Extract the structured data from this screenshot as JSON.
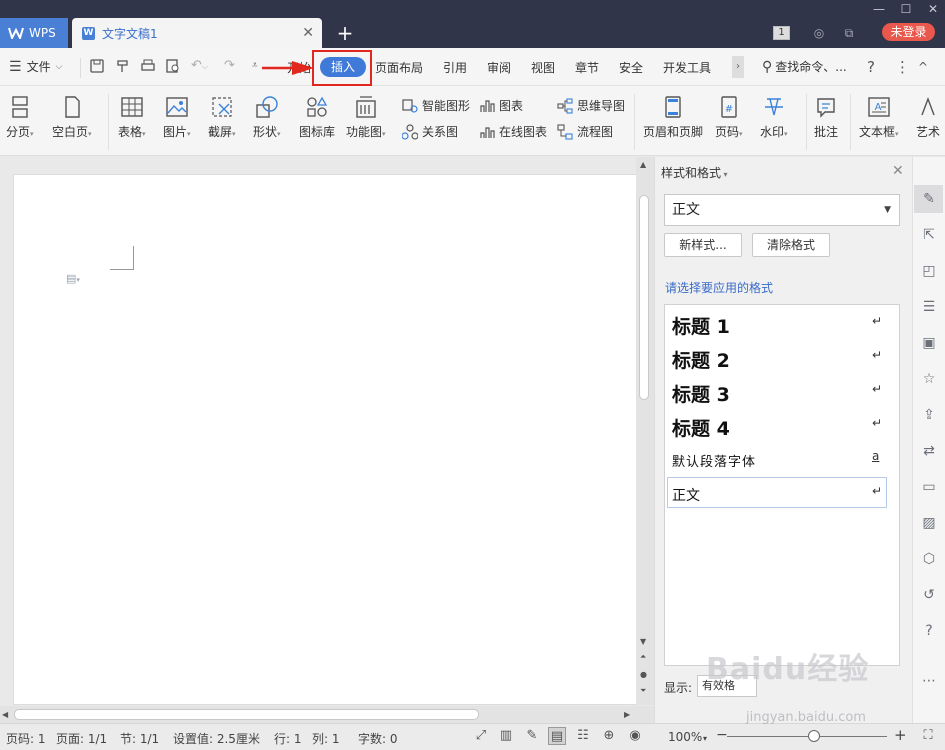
{
  "titlebar": {
    "app_tab": "WPS",
    "doc_tab": "文字文稿1",
    "doc_logo": "W",
    "window_count": "1",
    "login": "未登录",
    "colors": {
      "bg": "#30354a",
      "app_tab": "#4a7fd6",
      "login": "#e8584d"
    }
  },
  "menubar": {
    "file": "文件",
    "tabs": [
      "开始",
      "插入",
      "页面布局",
      "引用",
      "审阅",
      "视图",
      "章节",
      "安全",
      "开发工具"
    ],
    "active_tab": "插入",
    "search": "查找命令、...",
    "help": "?",
    "more": "⋮",
    "collapse": "^"
  },
  "ribbon": {
    "page_break": "分页",
    "blank_page": "空白页",
    "table": "表格",
    "picture": "图片",
    "screenshot": "截屏",
    "shapes": "形状",
    "icon_library": "图标库",
    "function_chart": "功能图",
    "smart_art": "智能图形",
    "chart": "图表",
    "relation_chart": "关系图",
    "online_chart": "在线图表",
    "mind_map": "思维导图",
    "flowchart": "流程图",
    "header_footer": "页眉和页脚",
    "page_number": "页码",
    "watermark": "水印",
    "comment": "批注",
    "text_box": "文本框",
    "art_text": "艺术"
  },
  "styles_pane": {
    "title": "样式和格式",
    "current_style": "正文",
    "new_style": "新样式...",
    "clear_format": "清除格式",
    "prompt": "请选择要应用的格式",
    "items": [
      {
        "label": "标题  1",
        "mark": "↵"
      },
      {
        "label": "标题  2",
        "mark": "↵"
      },
      {
        "label": "标题  3",
        "mark": "↵"
      },
      {
        "label": "标题  4",
        "mark": "↵"
      },
      {
        "label": "默认段落字体",
        "mark": "a"
      },
      {
        "label": "正文",
        "mark": "↵"
      }
    ],
    "show_label": "显示:",
    "show_value": "有效格"
  },
  "statusbar": {
    "page_code": "页码: 1",
    "pages": "页面: 1/1",
    "section": "节: 1/1",
    "setting": "设置值: 2.5厘米",
    "row": "行: 1",
    "col": "列: 1",
    "word_count": "字数: 0",
    "zoom": "100%",
    "zoom_out": "−",
    "zoom_in": "+",
    "zoom_level": 1.0
  },
  "watermark": {
    "logo": "Baidu经验",
    "url": "jingyan.baidu.com"
  }
}
